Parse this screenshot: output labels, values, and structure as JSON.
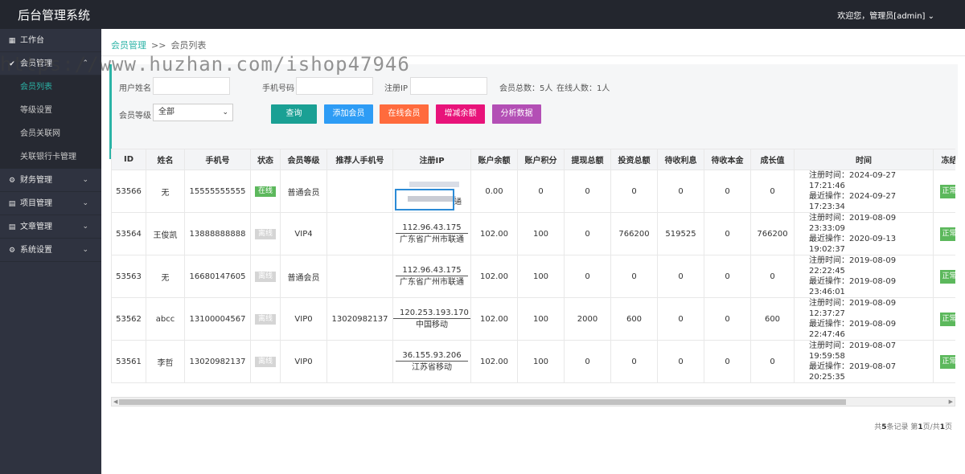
{
  "app": {
    "title": "后台管理系统",
    "welcome": "欢迎您，管理员[admin]"
  },
  "sidebar": {
    "items": [
      {
        "label": "工作台",
        "icon": "dashboard-icon",
        "expanded": false
      },
      {
        "label": "会员管理",
        "icon": "circle-check-icon",
        "expanded": true,
        "children": [
          "会员列表",
          "等级设置",
          "会员关联网",
          "关联银行卡管理"
        ]
      },
      {
        "label": "财务管理",
        "icon": "gear-icon",
        "expanded": false
      },
      {
        "label": "项目管理",
        "icon": "grid-icon",
        "expanded": false
      },
      {
        "label": "文章管理",
        "icon": "document-icon",
        "expanded": false
      },
      {
        "label": "系统设置",
        "icon": "gear-icon",
        "expanded": false
      }
    ],
    "active_child": "会员列表"
  },
  "breadcrumb": {
    "parent": "会员管理",
    "separator": ">>",
    "current": "会员列表"
  },
  "filter": {
    "username_label": "用户姓名",
    "phone_label": "手机号码",
    "ip_label": "注册IP",
    "total_members": "会员总数：5人",
    "online_members": "在线人数：1人",
    "level_label": "会员等级",
    "level_value": "全部",
    "buttons": {
      "search": "查询",
      "add": "添加会员",
      "online": "在线会员",
      "balance": "增减余额",
      "analyze": "分析数据"
    }
  },
  "colors": {
    "accent": "#2bb3a6",
    "search": "#1aa094",
    "add": "#2d9cf5",
    "online": "#ff6b3d",
    "balance": "#e8137a",
    "analyze": "#b34fb5",
    "topbar": "#23262e",
    "sidebar": "#2f3340"
  },
  "table": {
    "headers": [
      "ID",
      "姓名",
      "手机号",
      "状态",
      "会员等级",
      "推荐人手机号",
      "注册IP",
      "账户余额",
      "账户积分",
      "提现总额",
      "投资总额",
      "待收利息",
      "待收本金",
      "成长值",
      "时间",
      "冻结"
    ],
    "time_reg_label": "注册时间：",
    "time_last_label": "最近操作：",
    "rows": [
      {
        "id": "53566",
        "name": "无",
        "phone": "15555555555",
        "status": "在线",
        "online": true,
        "level": "普通会员",
        "referrer": "",
        "ip": "",
        "ip_loc": "",
        "ip_tail": "通",
        "ip_redacted": true,
        "balance": "0.00",
        "points": "0",
        "withdraw": "0",
        "invest": "0",
        "interest": "0",
        "principal": "0",
        "growth": "0",
        "reg_time": "2024-09-27 17:21:46",
        "last_time": "2024-09-27 17:23:34",
        "freeze": "正常"
      },
      {
        "id": "53564",
        "name": "王俊凯",
        "phone": "13888888888",
        "status": "离线",
        "online": false,
        "level": "VIP4",
        "referrer": "",
        "ip": "112.96.43.175",
        "ip_loc": "广东省广州市联通",
        "balance": "102.00",
        "points": "100",
        "withdraw": "0",
        "invest": "766200",
        "interest": "519525",
        "principal": "0",
        "growth": "766200",
        "reg_time": "2019-08-09 23:33:09",
        "last_time": "2020-09-13 19:02:37",
        "freeze": "正常"
      },
      {
        "id": "53563",
        "name": "无",
        "phone": "16680147605",
        "status": "离线",
        "online": false,
        "level": "普通会员",
        "referrer": "",
        "ip": "112.96.43.175",
        "ip_loc": "广东省广州市联通",
        "balance": "102.00",
        "points": "100",
        "withdraw": "0",
        "invest": "0",
        "interest": "0",
        "principal": "0",
        "growth": "0",
        "reg_time": "2019-08-09 22:22:45",
        "last_time": "2019-08-09 23:46:01",
        "freeze": "正常"
      },
      {
        "id": "53562",
        "name": "abcc",
        "phone": "13100004567",
        "status": "离线",
        "online": false,
        "level": "VIP0",
        "referrer": "13020982137",
        "ip": "120.253.193.170",
        "ip_loc": "中国移动",
        "balance": "102.00",
        "points": "100",
        "withdraw": "2000",
        "invest": "600",
        "interest": "0",
        "principal": "0",
        "growth": "600",
        "reg_time": "2019-08-09 12:37:27",
        "last_time": "2019-08-09 22:47:46",
        "freeze": "正常"
      },
      {
        "id": "53561",
        "name": "李哲",
        "phone": "13020982137",
        "status": "离线",
        "online": false,
        "level": "VIP0",
        "referrer": "",
        "ip": "36.155.93.206",
        "ip_loc": "江苏省移动",
        "balance": "102.00",
        "points": "100",
        "withdraw": "0",
        "invest": "0",
        "interest": "0",
        "principal": "0",
        "growth": "0",
        "reg_time": "2019-08-07 19:59:58",
        "last_time": "2019-08-07 20:25:35",
        "freeze": "正常"
      }
    ]
  },
  "pager": {
    "prefix": "共",
    "total": "5",
    "mid": "条记录 第",
    "page": "1",
    "of": "页/共",
    "pages": "1",
    "suffix": "页"
  },
  "watermark": "https://www.huzhan.com/ishop47946"
}
